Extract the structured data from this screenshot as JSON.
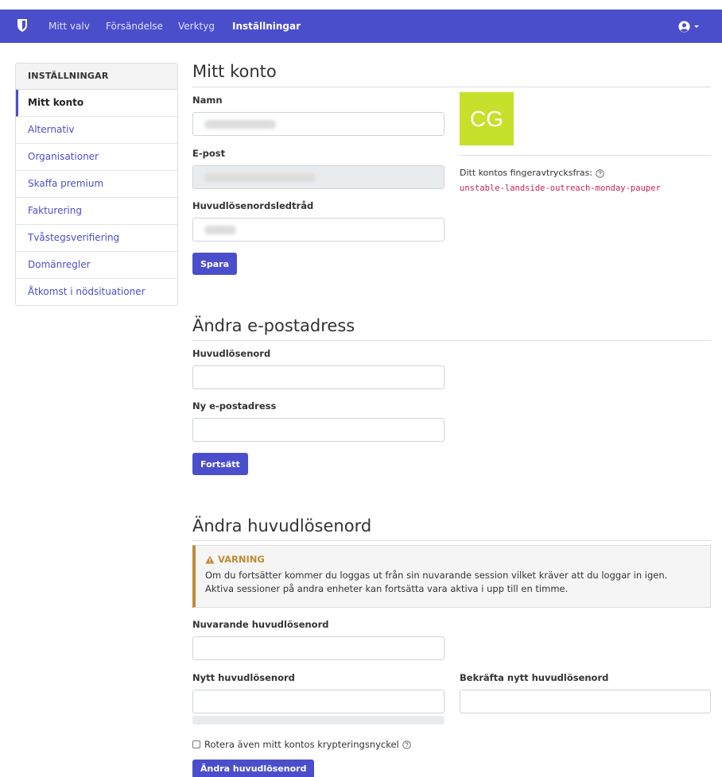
{
  "nav": {
    "items": [
      {
        "label": "Mitt valv"
      },
      {
        "label": "Försändelse"
      },
      {
        "label": "Verktyg"
      },
      {
        "label": "Inställningar"
      }
    ],
    "brand_color": "#4b4ecb"
  },
  "sidebar": {
    "header": "INSTÄLLNINGAR",
    "items": [
      {
        "label": "Mitt konto"
      },
      {
        "label": "Alternativ"
      },
      {
        "label": "Organisationer"
      },
      {
        "label": "Skaffa premium"
      },
      {
        "label": "Fakturering"
      },
      {
        "label": "Tvåstegsverifiering"
      },
      {
        "label": "Domänregler"
      },
      {
        "label": "Åtkomst i nödsituationer"
      }
    ]
  },
  "account": {
    "title": "Mitt konto",
    "name_label": "Namn",
    "email_label": "E-post",
    "hint_label": "Huvudlösenordsledtråd",
    "save_label": "Spara",
    "avatar_initials": "CG",
    "avatar_color": "#c6e02b",
    "fingerprint_label": "Ditt kontos fingeravtrycksfras:",
    "fingerprint_phrase": "unstable-landside-outreach-monday-pauper"
  },
  "change_email": {
    "title": "Ändra e-postadress",
    "master_password_label": "Huvudlösenord",
    "new_email_label": "Ny e-postadress",
    "continue_label": "Fortsätt"
  },
  "change_password": {
    "title": "Ändra huvudlösenord",
    "warning_title": "VARNING",
    "warning_line1": "Om du fortsätter kommer du loggas ut från sin nuvarande session vilket kräver att du loggar in igen.",
    "warning_line2": "Aktiva sessioner på andra enheter kan fortsätta vara aktiva i upp till en timme.",
    "current_label": "Nuvarande huvudlösenord",
    "new_label": "Nytt huvudlösenord",
    "confirm_label": "Bekräfta nytt huvudlösenord",
    "rotate_label": "Rotera även mitt kontos krypteringsnyckel",
    "submit_label": "Ändra huvudlösenord",
    "warning_color": "#bf8b34"
  }
}
